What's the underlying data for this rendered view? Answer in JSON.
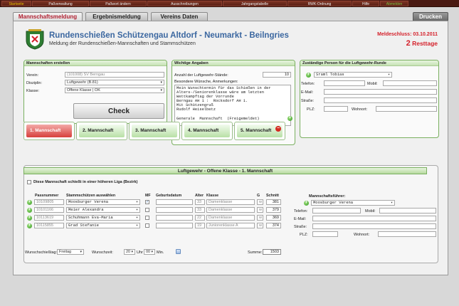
{
  "nav": [
    "Startseite",
    "Paßverwaltung",
    "Paßwort ändern",
    "Ausschreibungen",
    "Jahrgangstabelle",
    "RWK-Ordnung",
    "Hilfe",
    "Abmelden"
  ],
  "tabs": {
    "items": [
      "Mannschaftsmeldung",
      "Ergebnismeldung",
      "Vereins Daten"
    ],
    "print": "Drucken"
  },
  "header": {
    "title": "Rundenschießen Schützengau Altdorf - Neumarkt - Beilngries",
    "subtitle": "Meldung der Rundenschießen-Mannschaften und Stammschützen",
    "deadline": "Meldeschluss: 03.10.2011",
    "rest_count": "2",
    "rest_label": "Resttage"
  },
  "create": {
    "heading": "Mannschaften erstellen",
    "verein_label": "Verein:",
    "verein_value": "(101008) SV Berngau",
    "disziplin_label": "Disziplin:",
    "disziplin_value": "Luftgewehr (B.81)",
    "klasse_label": "Klasse:",
    "klasse_value": "Offene Klasse | OK",
    "check": "Check"
  },
  "info": {
    "heading": "Wichtige Angaben",
    "stands_label": "Anzahl der Luftgewehr-Stände:",
    "stands_value": "10",
    "wishes_label": "Besondere Wünsche, Anmerkungen:",
    "wishes_text": "Mein Wunschtermin für das Schießen in der\nAlters-/Seniorenklasse wäre am letzten\nWettkampftag der Vorrunde\nBerngau AH 1 :  Rocksdorf AH 1.\nMit Schützengruß\nRudolf Heiselbetz\n\nGenerale  Mannschaft  (Freigemeldet)"
  },
  "contact": {
    "heading": "Zuständige Person für die Luftgewehr-Runde",
    "person": "Sraml Tobias",
    "telefon": "Telefon:",
    "mobil": "Mobil:",
    "email": "E-Mail:",
    "strasse": "Straße:",
    "plz": "PLZ:",
    "wohnort": "Wohnort:"
  },
  "teams": [
    "1. Mannschaft",
    "2. Mannschaft",
    "3. Mannschaft",
    "4. Mannschaft",
    "5. Mannschaft"
  ],
  "detail": {
    "header": "Luftgewehr - Offene Klasse - 1. Mannschaft",
    "higher_league": "Diese Mannschaft schießt in einer höheren Liga (Bezirk)",
    "columns": [
      "Passnummer",
      "Stammschützen auswählen",
      "MF",
      "Geburtsdatum",
      "Alter",
      "Klasse",
      "G",
      "Schnitt"
    ],
    "shooters": [
      {
        "pass": "10109805",
        "name": "Moosburger Verena",
        "mf": true,
        "age": "33",
        "klasse": "Damenklasse",
        "g": "w",
        "schnitt": "381"
      },
      {
        "pass": "10101166",
        "name": "Meier Alexandra",
        "mf": false,
        "age": "33",
        "klasse": "Damenklasse",
        "g": "w",
        "schnitt": "379"
      },
      {
        "pass": "10113619",
        "name": "Schuhmann Eva-Maria",
        "mf": false,
        "age": "22",
        "klasse": "Damenklasse",
        "g": "w",
        "schnitt": "369"
      },
      {
        "pass": "10115855",
        "name": "Grad Stefanie",
        "mf": false,
        "age": "19",
        "klasse": "Juniorenklasse A",
        "g": "w",
        "schnitt": "374"
      }
    ],
    "leader_heading": "Mannschaftsführer:",
    "leader": "Moosburger Verena",
    "wunsch_tag_label": "Wunschschießtag:",
    "wunsch_tag": "Freitag",
    "wunsch_zeit_label": "Wunschzeit:",
    "hour": "20",
    "uhr": "Uhr",
    "minute": "00",
    "min": "Min.",
    "summe_label": "Summe:",
    "summe": "1503"
  }
}
